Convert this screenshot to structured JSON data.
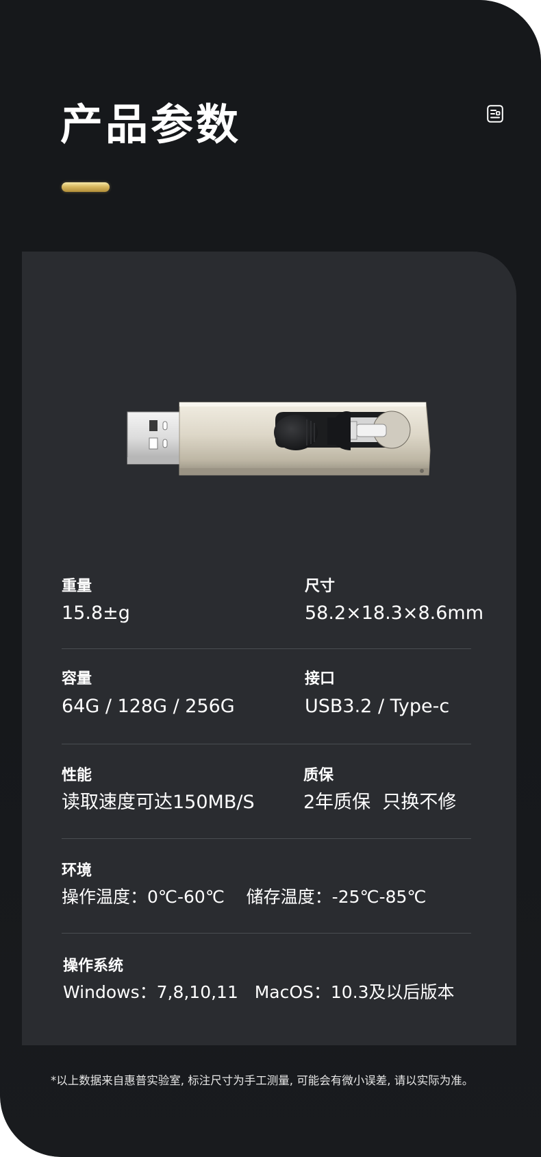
{
  "header": {
    "title": "产品参数",
    "icon": "document-icon",
    "accent_color": "#d9b960"
  },
  "product_image": {
    "subject": "usb-flash-drive-image"
  },
  "specs": {
    "weight": {
      "label": "重量",
      "value": "15.8±g"
    },
    "size": {
      "label": "尺寸",
      "value": "58.2×18.3×8.6mm"
    },
    "capacity": {
      "label": "容量",
      "value": "64G / 128G / 256G"
    },
    "interface": {
      "label": "接口",
      "value": "USB3.2 / Type-c"
    },
    "performance": {
      "label": "性能",
      "value": "读取速度可达150MB/S"
    },
    "warranty": {
      "label": "质保",
      "value": "2年质保  只换不修"
    },
    "environment": {
      "label": "环境",
      "value": "操作温度：0℃-60℃    储存温度：-25℃-85℃"
    },
    "os": {
      "label": "操作系统",
      "value": "Windows：7,8,10,11   MacOS：10.3及以后版本"
    }
  },
  "footnote": "*以上数据来自惠普实验室, 标注尺寸为手工测量, 可能会有微小误差, 请以实际为准。"
}
